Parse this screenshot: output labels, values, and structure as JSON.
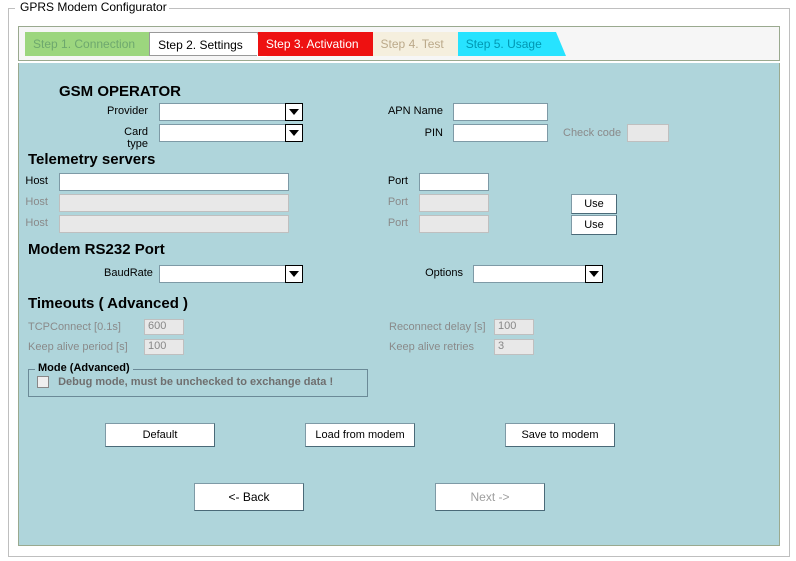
{
  "window_title": "GPRS Modem Configurator",
  "tabs": {
    "connection": "Step 1. Connection",
    "settings": "Step 2. Settings",
    "activation": "Step 3. Activation",
    "test": "Step 4. Test",
    "usage": "Step 5. Usage"
  },
  "gsm": {
    "heading": "GSM OPERATOR",
    "provider_label": "Provider",
    "cardtype_label": "Card type",
    "apn_label": "APN Name",
    "pin_label": "PIN",
    "check_code_label": "Check code"
  },
  "telemetry": {
    "heading": "Telemetry servers",
    "host_label": "Host",
    "port_label": "Port",
    "use_label": "Use"
  },
  "rs232": {
    "heading": "Modem RS232 Port",
    "baud_label": "BaudRate",
    "options_label": "Options"
  },
  "timeouts": {
    "heading": "Timeouts ( Advanced )",
    "tcp_label": "TCPConnect [0.1s]",
    "tcp_value": "600",
    "keepalive_label": "Keep alive period [s]",
    "keepalive_value": "100",
    "reconnect_label": "Reconnect delay [s]",
    "reconnect_value": "100",
    "retries_label": "Keep alive retries",
    "retries_value": "3"
  },
  "mode": {
    "legend": "Mode (Advanced)",
    "debug_label": "Debug mode, must be unchecked to exchange data !"
  },
  "buttons": {
    "default": "Default",
    "load": "Load from modem",
    "save": "Save to modem",
    "back": "<- Back",
    "next": "Next ->"
  }
}
